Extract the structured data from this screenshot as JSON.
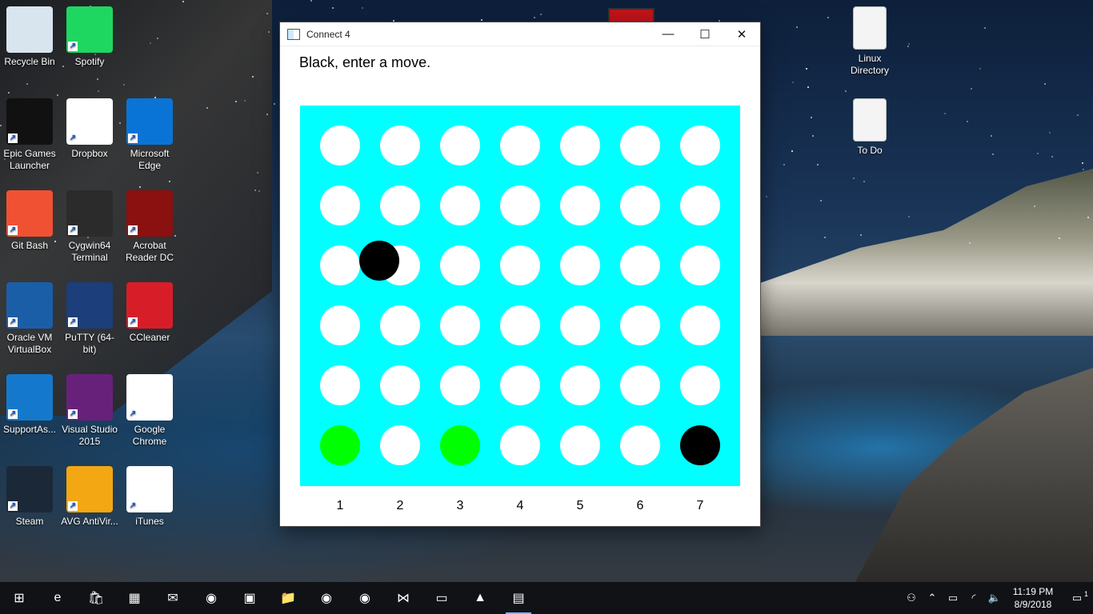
{
  "desktop": {
    "icons_left": [
      {
        "label": "Recycle Bin",
        "icon": "recycle-bin-icon"
      },
      {
        "label": "Spotify",
        "icon": "spotify-icon"
      },
      {
        "label": "Epic Games Launcher",
        "icon": "epic-games-icon"
      },
      {
        "label": "Dropbox",
        "icon": "dropbox-icon"
      },
      {
        "label": "Microsoft Edge",
        "icon": "edge-icon"
      },
      {
        "label": "Git Bash",
        "icon": "git-bash-icon"
      },
      {
        "label": "Cygwin64 Terminal",
        "icon": "cygwin-icon"
      },
      {
        "label": "Acrobat Reader DC",
        "icon": "acrobat-icon"
      },
      {
        "label": "Oracle VM VirtualBox",
        "icon": "virtualbox-icon"
      },
      {
        "label": "PuTTY (64-bit)",
        "icon": "putty-icon"
      },
      {
        "label": "CCleaner",
        "icon": "ccleaner-icon"
      },
      {
        "label": "SupportAs...",
        "icon": "supportassist-icon"
      },
      {
        "label": "Visual Studio 2015",
        "icon": "visual-studio-icon"
      },
      {
        "label": "Google Chrome",
        "icon": "chrome-icon"
      },
      {
        "label": "Steam",
        "icon": "steam-icon"
      },
      {
        "label": "AVG AntiVir...",
        "icon": "avg-icon"
      },
      {
        "label": "iTunes",
        "icon": "itunes-icon"
      }
    ],
    "icons_right": [
      {
        "label": "Linux Directory",
        "icon": "document-icon"
      },
      {
        "label": "To Do",
        "icon": "document-icon"
      }
    ]
  },
  "window": {
    "title": "Connect 4",
    "minimize": "—",
    "maximize": "☐",
    "close": "✕"
  },
  "game": {
    "status": "Black, enter a move.",
    "columns": [
      "1",
      "2",
      "3",
      "4",
      "5",
      "6",
      "7"
    ],
    "colors": {
      "board": "#00ffff",
      "empty": "#ffffff",
      "black": "#000000",
      "green": "#00ff00"
    },
    "grid": [
      [
        "empty",
        "empty",
        "empty",
        "empty",
        "empty",
        "empty",
        "empty"
      ],
      [
        "empty",
        "empty",
        "empty",
        "empty",
        "empty",
        "empty",
        "empty"
      ],
      [
        "empty",
        "empty",
        "empty",
        "empty",
        "empty",
        "empty",
        "empty"
      ],
      [
        "empty",
        "empty",
        "empty",
        "empty",
        "empty",
        "empty",
        "empty"
      ],
      [
        "empty",
        "empty",
        "empty",
        "empty",
        "empty",
        "empty",
        "empty"
      ],
      [
        "green",
        "empty",
        "green",
        "empty",
        "empty",
        "empty",
        "black"
      ]
    ],
    "stray_piece": {
      "color": "black",
      "col": 1,
      "row": 3
    }
  },
  "taskbar": {
    "items": [
      {
        "icon": "start-icon",
        "glyph": "⊞"
      },
      {
        "icon": "edge-icon",
        "glyph": "e"
      },
      {
        "icon": "store-icon",
        "glyph": "🛍"
      },
      {
        "icon": "contacts-icon",
        "glyph": "▦"
      },
      {
        "icon": "mail-icon",
        "glyph": "✉"
      },
      {
        "icon": "chrome-icon",
        "glyph": "◉"
      },
      {
        "icon": "app-icon",
        "glyph": "▣"
      },
      {
        "icon": "file-explorer-icon",
        "glyph": "📁"
      },
      {
        "icon": "chrome-icon",
        "glyph": "◉"
      },
      {
        "icon": "chrome-icon",
        "glyph": "◉"
      },
      {
        "icon": "visual-studio-icon",
        "glyph": "⋈"
      },
      {
        "icon": "monitor-icon",
        "glyph": "▭"
      },
      {
        "icon": "photos-icon",
        "glyph": "▲"
      },
      {
        "icon": "connect4-icon",
        "glyph": "▤"
      }
    ],
    "time": "11:19 PM",
    "date": "8/9/2018",
    "notification_count": "1"
  }
}
